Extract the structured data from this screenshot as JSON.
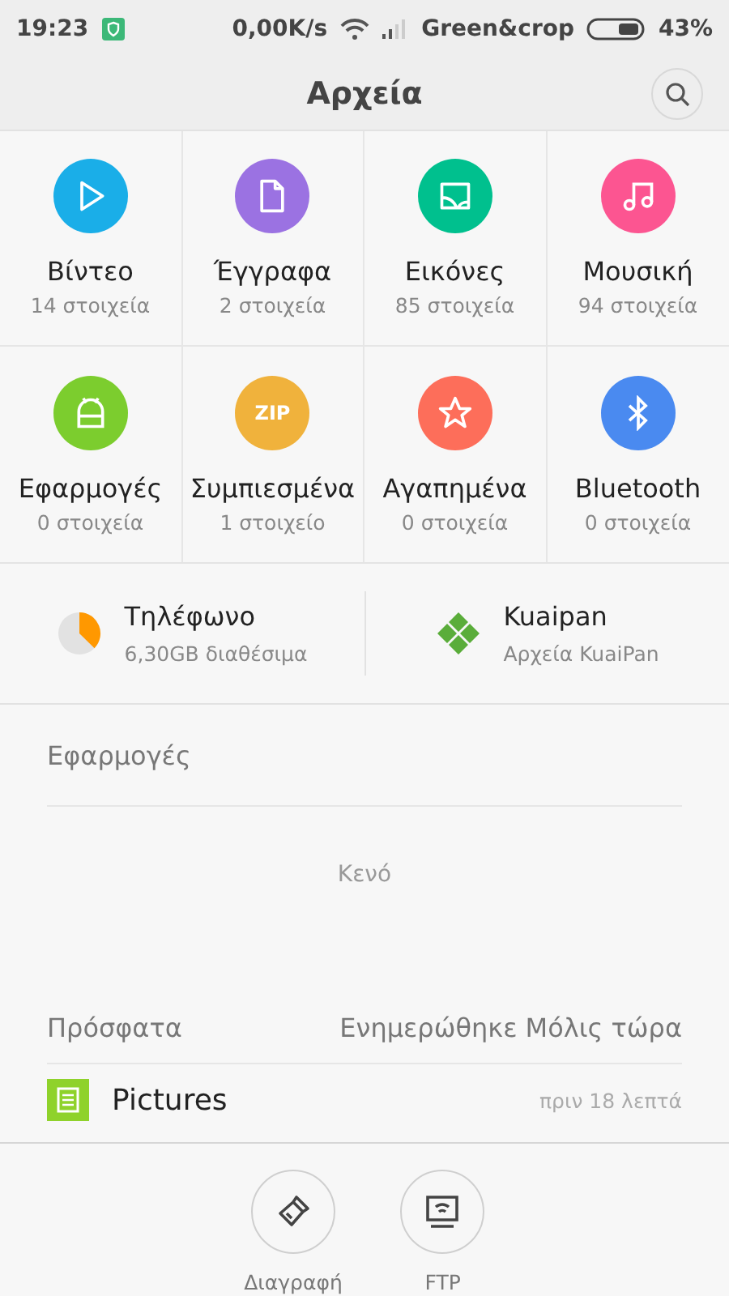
{
  "status_bar": {
    "time": "19:23",
    "speed": "0,00K/s",
    "carrier": "Green&crop",
    "battery": "43%"
  },
  "header": {
    "title": "Αρχεία"
  },
  "categories": [
    {
      "kind": "video",
      "name": "Βίντεο",
      "count": "14 στοιχεία",
      "color": "#1aaee8"
    },
    {
      "kind": "document",
      "name": "Έγγραφα",
      "count": "2 στοιχεία",
      "color": "#9b72e2"
    },
    {
      "kind": "image",
      "name": "Εικόνες",
      "count": "85 στοιχεία",
      "color": "#00c08e"
    },
    {
      "kind": "music",
      "name": "Μουσική",
      "count": "94 στοιχεία",
      "color": "#fc5591"
    },
    {
      "kind": "apps",
      "name": "Εφαρμογές",
      "count": "0 στοιχεία",
      "color": "#7ccd2e"
    },
    {
      "kind": "zip",
      "name": "Συμπιεσμένα",
      "count": "1 στοιχείο",
      "color": "#f0b23c",
      "icon_text": "ZIP"
    },
    {
      "kind": "star",
      "name": "Αγαπημένα",
      "count": "0 στοιχεία",
      "color": "#fd6e5a"
    },
    {
      "kind": "bluetooth",
      "name": "Bluetooth",
      "count": "0 στοιχεία",
      "color": "#4a8af0"
    }
  ],
  "storage": [
    {
      "kind": "phone",
      "name": "Τηλέφωνο",
      "detail": "6,30GB διαθέσιμα"
    },
    {
      "kind": "cloud",
      "name": "Kuaipan",
      "detail": "Αρχεία KuaiPan"
    }
  ],
  "apps_section": {
    "title": "Εφαρμογές",
    "empty_text": "Κενό"
  },
  "recent": {
    "title": "Πρόσφατα",
    "updated": "Ενημερώθηκε Μόλις τώρα",
    "items": [
      {
        "name": "Pictures",
        "time": "πριν 18 λεπτά"
      }
    ]
  },
  "bottom_actions": [
    {
      "kind": "clean",
      "label": "Διαγραφή"
    },
    {
      "kind": "ftp",
      "label": "FTP"
    }
  ]
}
